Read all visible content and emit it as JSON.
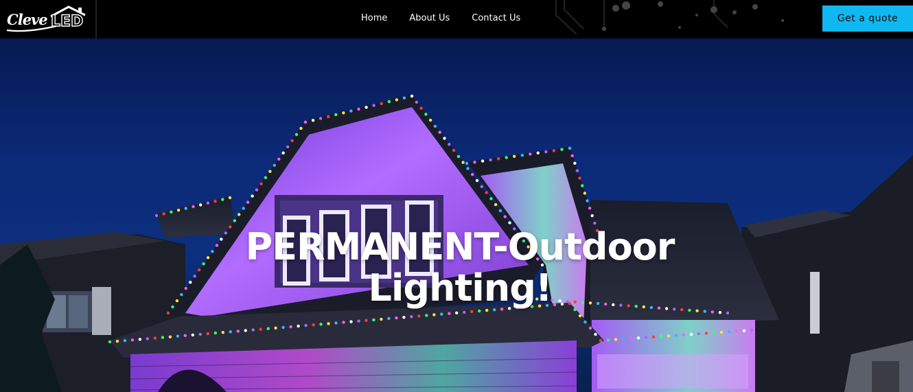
{
  "brand": {
    "logo_text_script": "Cleve",
    "logo_text_block": "LED"
  },
  "nav": {
    "items": [
      {
        "label": "Home"
      },
      {
        "label": "About Us"
      },
      {
        "label": "Contact Us"
      }
    ]
  },
  "header": {
    "cta_label": "Get a quote"
  },
  "hero": {
    "title": "PERMANENT-Outdoor Lighting!",
    "image_alt": ""
  },
  "colors": {
    "header_bg": "#000000",
    "cta_bg": "#0fb8f0",
    "sky": "#0b2a78",
    "facade_glow": "#b66bff"
  },
  "icons": {
    "logo_roof": "house-roof-icon"
  }
}
